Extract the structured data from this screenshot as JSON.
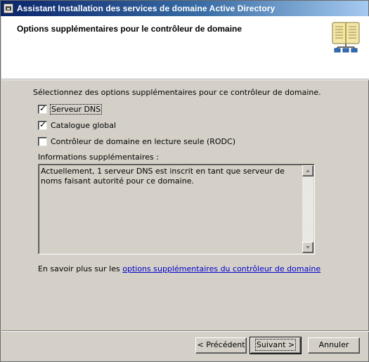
{
  "window": {
    "title": "Assistant Installation des services de domaine Active Directory"
  },
  "header": {
    "heading": "Options supplémentaires pour le contrôleur de domaine",
    "icon": "book-icon"
  },
  "main": {
    "intro": "Sélectionnez des options supplémentaires pour ce contrôleur de domaine.",
    "options": [
      {
        "label": "Serveur DNS",
        "checked": true
      },
      {
        "label": "Catalogue global",
        "checked": true
      },
      {
        "label": "Contrôleur de domaine en lecture seule (RODC)",
        "checked": false
      }
    ],
    "info_label": "Informations supplémentaires :",
    "info_text": "Actuellement, 1 serveur DNS est inscrit en tant que serveur de noms faisant autorité pour ce domaine.",
    "more_info_prefix": "En savoir plus sur les",
    "more_info_link": "options supplémentaires du contrôleur de domaine"
  },
  "footer": {
    "back_prefix": "< ",
    "back_label": "Précédent",
    "next_label": "Suivant",
    "next_suffix": " >",
    "cancel_label": "Annuler"
  },
  "colors": {
    "title_gradient_start": "#0a246a",
    "title_gradient_end": "#a6caf0",
    "dialog_face": "#d4d0c8",
    "link": "#0000cc"
  }
}
